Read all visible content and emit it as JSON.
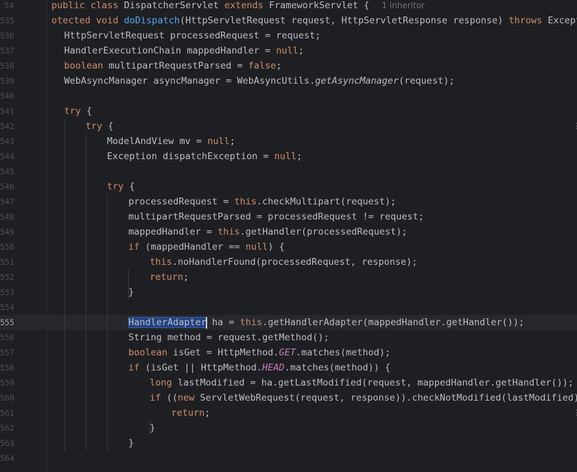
{
  "editor": {
    "lines": [
      {
        "n": "54",
        "tokens": [
          [
            "kw",
            "public "
          ],
          [
            "kw",
            "class "
          ],
          [
            "",
            "DispatcherServlet "
          ],
          [
            "kw",
            "extends "
          ],
          [
            "",
            "FrameworkServlet { "
          ]
        ],
        "hint": "1 inheritor"
      },
      {
        "n": "535",
        "tokens": [
          [
            "kw",
            "otected "
          ],
          [
            "kw",
            "void "
          ],
          [
            "fn",
            "doDispatch"
          ],
          [
            "",
            "(HttpServletRequest request, HttpServletResponse response) "
          ],
          [
            "kw",
            "throws "
          ],
          [
            "",
            "Exception"
          ]
        ]
      },
      {
        "n": "536",
        "indent": 1,
        "tokens": [
          [
            "",
            "HttpServletRequest processedRequest = request;"
          ]
        ]
      },
      {
        "n": "537",
        "indent": 1,
        "tokens": [
          [
            "",
            "HandlerExecutionChain mappedHandler = "
          ],
          [
            "kw",
            "null"
          ],
          [
            "",
            ";"
          ]
        ]
      },
      {
        "n": "538",
        "indent": 1,
        "tokens": [
          [
            "kw",
            "boolean "
          ],
          [
            "",
            "multipartRequestParsed = "
          ],
          [
            "kw",
            "false"
          ],
          [
            "",
            ";"
          ]
        ]
      },
      {
        "n": "539",
        "indent": 1,
        "tokens": [
          [
            "",
            "WebAsyncManager asyncManager = WebAsyncUtils."
          ],
          [
            "it",
            "getAsyncManager"
          ],
          [
            "",
            "(request);"
          ]
        ]
      },
      {
        "n": "540",
        "tokens": []
      },
      {
        "n": "541",
        "indent": 1,
        "tokens": [
          [
            "kw",
            "try "
          ],
          [
            "",
            "{"
          ]
        ]
      },
      {
        "n": "542",
        "indent": 2,
        "tokens": [
          [
            "kw",
            "try "
          ],
          [
            "",
            "{"
          ]
        ]
      },
      {
        "n": "543",
        "indent": 3,
        "tokens": [
          [
            "",
            "ModelAndView mv = "
          ],
          [
            "kw",
            "null"
          ],
          [
            "",
            ";"
          ]
        ]
      },
      {
        "n": "544",
        "indent": 3,
        "tokens": [
          [
            "",
            "Exception dispatchException = "
          ],
          [
            "kw",
            "null"
          ],
          [
            "",
            ";"
          ]
        ]
      },
      {
        "n": "545",
        "tokens": []
      },
      {
        "n": "546",
        "indent": 3,
        "tokens": [
          [
            "kw",
            "try "
          ],
          [
            "",
            "{"
          ]
        ]
      },
      {
        "n": "547",
        "indent": 4,
        "tokens": [
          [
            "",
            "processedRequest = "
          ],
          [
            "kw",
            "this"
          ],
          [
            "",
            ".checkMultipart(request);"
          ]
        ]
      },
      {
        "n": "548",
        "indent": 4,
        "tokens": [
          [
            "",
            "multipartRequestParsed = processedRequest != request;"
          ]
        ]
      },
      {
        "n": "549",
        "indent": 4,
        "tokens": [
          [
            "",
            "mappedHandler = "
          ],
          [
            "kw",
            "this"
          ],
          [
            "",
            ".getHandler(processedRequest);"
          ]
        ]
      },
      {
        "n": "550",
        "indent": 4,
        "tokens": [
          [
            "kw",
            "if "
          ],
          [
            "",
            "(mappedHandler == "
          ],
          [
            "kw",
            "null"
          ],
          [
            "",
            ") {"
          ]
        ]
      },
      {
        "n": "551",
        "indent": 5,
        "tokens": [
          [
            "kw",
            "this"
          ],
          [
            "",
            ".noHandlerFound(processedRequest, response);"
          ]
        ]
      },
      {
        "n": "552",
        "indent": 5,
        "tokens": [
          [
            "kw",
            "return"
          ],
          [
            "",
            ";"
          ]
        ]
      },
      {
        "n": "553",
        "indent": 4,
        "tokens": [
          [
            "",
            "}"
          ]
        ]
      },
      {
        "n": "554",
        "tokens": []
      },
      {
        "n": "555",
        "indent": 4,
        "current": true,
        "tokens": [
          [
            "hl",
            "HandlerAdapter"
          ],
          [
            "caret",
            ""
          ],
          [
            "",
            " ha = "
          ],
          [
            "kw",
            "this"
          ],
          [
            "",
            ".getHandlerAdapter(mappedHandler.getHandler());"
          ]
        ]
      },
      {
        "n": "556",
        "indent": 4,
        "tokens": [
          [
            "",
            "String method = request.getMethod();"
          ]
        ]
      },
      {
        "n": "557",
        "indent": 4,
        "tokens": [
          [
            "kw",
            "boolean "
          ],
          [
            "",
            "isGet = HttpMethod."
          ],
          [
            "st",
            "GET"
          ],
          [
            "",
            ".matches(method);"
          ]
        ]
      },
      {
        "n": "558",
        "indent": 4,
        "tokens": [
          [
            "kw",
            "if "
          ],
          [
            "",
            "(isGet || HttpMethod."
          ],
          [
            "st",
            "HEAD"
          ],
          [
            "",
            ".matches(method)) {"
          ]
        ]
      },
      {
        "n": "559",
        "indent": 5,
        "tokens": [
          [
            "kw",
            "long "
          ],
          [
            "",
            "lastModified = ha.getLastModified(request, mappedHandler.getHandler());"
          ]
        ]
      },
      {
        "n": "560",
        "indent": 5,
        "tokens": [
          [
            "kw",
            "if "
          ],
          [
            "",
            "(("
          ],
          [
            "kw",
            "new "
          ],
          [
            "",
            "ServletWebRequest(request, response)).checkNotModified(lastModified) &&"
          ]
        ]
      },
      {
        "n": "561",
        "indent": 6,
        "tokens": [
          [
            "kw",
            "return"
          ],
          [
            "",
            ";"
          ]
        ]
      },
      {
        "n": "562",
        "indent": 5,
        "tokens": [
          [
            "",
            "}"
          ]
        ]
      },
      {
        "n": "563",
        "indent": 4,
        "tokens": [
          [
            "",
            "}"
          ]
        ]
      },
      {
        "n": "564",
        "tokens": []
      }
    ]
  }
}
